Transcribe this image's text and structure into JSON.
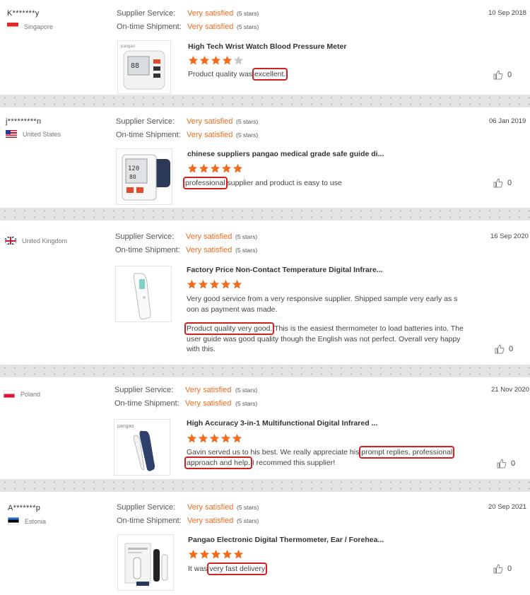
{
  "labels": {
    "supplier_service": "Supplier Service:",
    "shipment": "On-time Shipment:"
  },
  "star_color": "#f26b1d",
  "highlight_color": "#d02020",
  "reviews": [
    {
      "user": "K*******y",
      "country": "Singapore",
      "supplier_value": "Very satisfied",
      "supplier_stars": "(5 stars)",
      "shipment_value": "Very satisfied",
      "shipment_stars": "(5 stars)",
      "date": "10 Sep 2018",
      "product_title": "High Tech Wrist Watch Blood Pressure Meter",
      "rating": 4,
      "text_pre": "Product quality was ",
      "text_hl": "excellent.",
      "text_post": "",
      "likes": "0"
    },
    {
      "user": "j*********n",
      "country": "United States",
      "supplier_value": "Very satisfied",
      "supplier_stars": "(5 stars)",
      "shipment_value": "Very satisfied",
      "shipment_stars": "(5 stars)",
      "date": "06 Jan 2019",
      "product_title": "chinese suppliers pangao medical grade safe guide di...",
      "rating": 5,
      "text_pre": "",
      "text_hl": "professional",
      "text_post": " supplier and product is easy to use",
      "likes": "0"
    },
    {
      "user": "",
      "country": "United Kingdom",
      "supplier_value": "Very satisfied",
      "supplier_stars": "(5 stars)",
      "shipment_value": "Very satisfied",
      "shipment_stars": "(5 stars)",
      "date": "16 Sep 2020",
      "product_title": "Factory Price Non-Contact Temperature Digital Infrare...",
      "rating": 5,
      "text_a": "Very good service from a very responsive supplier. Shipped sample very early as s oon as payment was made.",
      "text_hl": "Product quality very good.",
      "text_post": " This is the easiest thermometer to load batteries into. The user guide was good quality though the English was not perfect. Overall very happy with this.",
      "likes": "0"
    },
    {
      "user": "",
      "country": "Poland",
      "supplier_value": "Very satisfied",
      "supplier_stars": "(5 stars)",
      "shipment_value": "Very satisfied",
      "shipment_stars": "(5 stars)",
      "date": "21 Nov 2020",
      "product_title": "High Accuracy 3-in-1 Multifunctional Digital Infrared ...",
      "rating": 5,
      "text_pre": "Gavin served us to his best. We really appreciate his ",
      "text_hl": "prompt replies, professional",
      "text_hl2": "approach and help.",
      "text_post": " I recommed this supplier!",
      "likes": "0"
    },
    {
      "user": "A*******p",
      "country": "Estonia",
      "supplier_value": "Very satisfied",
      "supplier_stars": "(5 stars)",
      "shipment_value": "Very satisfied",
      "shipment_stars": "(5 stars)",
      "date": "20 Sep 2021",
      "product_title": "Pangao Electronic Digital Thermometer, Ear / Forehea...",
      "rating": 5,
      "text_pre": "It was ",
      "text_hl": "very fast delivery",
      "text_post": "",
      "likes": "0"
    }
  ]
}
